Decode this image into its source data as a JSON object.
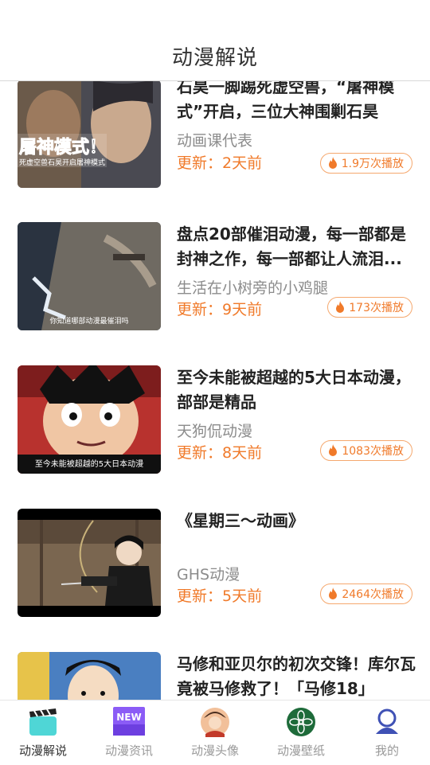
{
  "header": {
    "title": "动漫解说"
  },
  "items": [
    {
      "title": "石昊一脚踢死虚空兽，“屠神模式”开启，三位大神围剿石昊",
      "author": "动画课代表",
      "updated": "更新：2天前",
      "plays": "1.9万次播放",
      "caption": "屠神模式！",
      "subcaption": "死虚空兽石昊开启屠神模式"
    },
    {
      "title": "盘点20部催泪动漫，每一部都是封神之作，每一部都让人流泪...",
      "author": "生活在小树旁的小鸡腿",
      "updated": "更新：9天前",
      "plays": "173次播放",
      "caption": "你知道哪部动漫最催泪吗"
    },
    {
      "title": "至今未能被超越的5大日本动漫，部部是精品",
      "author": "天狗侃动漫",
      "updated": "更新：8天前",
      "plays": "1083次播放",
      "caption": "至今未能被超越的5大日本动漫"
    },
    {
      "title": "《星期三～动画》",
      "author": "GHS动漫",
      "updated": "更新：5天前",
      "plays": "2464次播放"
    },
    {
      "title": "马修和亚贝尔的初次交锋！库尔瓦竟被马修救了！「马修18」",
      "author": "",
      "updated": "",
      "plays": ""
    }
  ],
  "tabs": [
    {
      "label": "动漫解说",
      "icon": "clapperboard-icon",
      "active": true
    },
    {
      "label": "动漫资讯",
      "icon": "new-badge-icon",
      "badge": "NEW",
      "active": false
    },
    {
      "label": "动漫头像",
      "icon": "avatar-face-icon",
      "active": false
    },
    {
      "label": "动漫壁纸",
      "icon": "flower-icon",
      "active": false
    },
    {
      "label": "我的",
      "icon": "user-icon",
      "active": false
    }
  ],
  "colors": {
    "accent": "#f07a2a",
    "badge_border": "#f5a86e",
    "tab_active_icon": "#4fd6d6",
    "new_badge": "#8b5cf6",
    "wallpaper_icon": "#1e6b3a",
    "user_icon": "#3f51b5"
  }
}
